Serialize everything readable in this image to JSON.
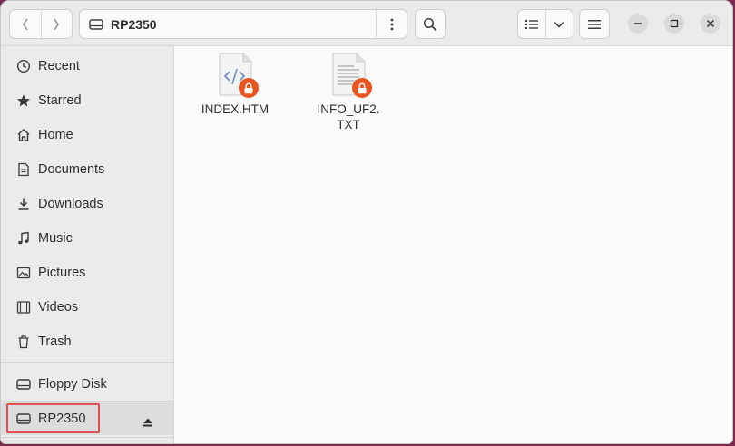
{
  "window": {
    "location": "RP2350"
  },
  "sidebar": {
    "items": [
      {
        "label": "Recent",
        "icon": "clock-icon"
      },
      {
        "label": "Starred",
        "icon": "star-icon"
      },
      {
        "label": "Home",
        "icon": "home-icon"
      },
      {
        "label": "Documents",
        "icon": "document-icon"
      },
      {
        "label": "Downloads",
        "icon": "download-icon"
      },
      {
        "label": "Music",
        "icon": "music-icon"
      },
      {
        "label": "Pictures",
        "icon": "picture-icon"
      },
      {
        "label": "Videos",
        "icon": "video-icon"
      },
      {
        "label": "Trash",
        "icon": "trash-icon"
      }
    ],
    "devices": [
      {
        "label": "Floppy Disk",
        "icon": "drive-icon"
      },
      {
        "label": "RP2350",
        "icon": "drive-icon",
        "selected": true
      }
    ]
  },
  "files": [
    {
      "name": "INDEX.HTM",
      "type": "html",
      "locked": true
    },
    {
      "name": "INFO_UF2.\nTXT",
      "type": "text",
      "locked": true
    }
  ],
  "colors": {
    "accent": "#e95420",
    "highlight": "#e05050"
  }
}
